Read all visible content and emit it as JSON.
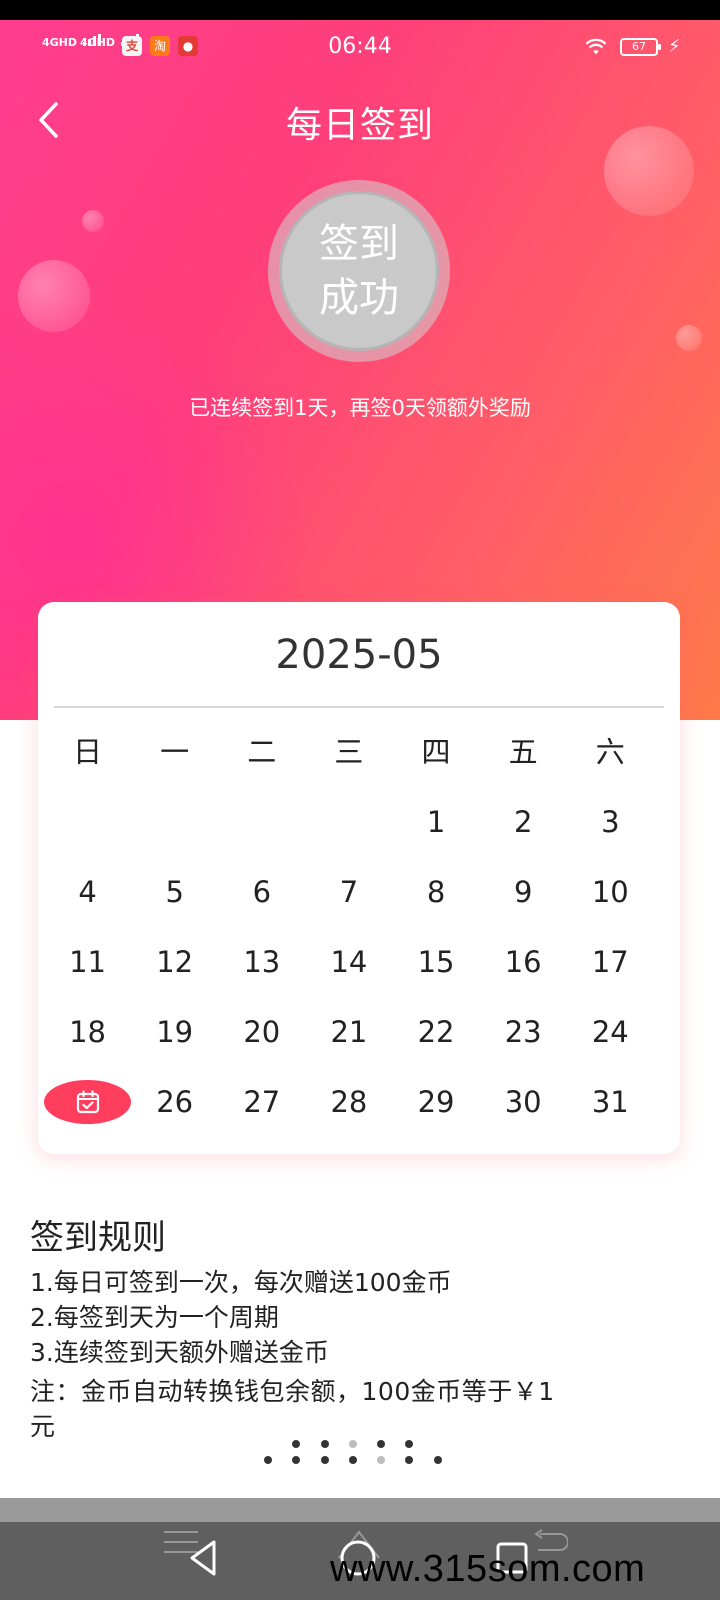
{
  "status_bar": {
    "time": "06:44",
    "signal_1": "4GHD",
    "signal_2": "4GHD",
    "battery": "67",
    "notification_icons": [
      "alipay-icon",
      "taobao-icon",
      "app-red-icon"
    ]
  },
  "header": {
    "title": "每日签到"
  },
  "signin": {
    "line1": "签到",
    "line2": "成功",
    "streak_text": "已连续签到1天，再签0天领额外奖励"
  },
  "calendar": {
    "month": "2025-05",
    "weekdays": [
      "日",
      "一",
      "二",
      "三",
      "四",
      "五",
      "六"
    ],
    "rows": [
      [
        "",
        "",
        "",
        "",
        "1",
        "2",
        "3"
      ],
      [
        "4",
        "5",
        "6",
        "7",
        "8",
        "9",
        "10"
      ],
      [
        "11",
        "12",
        "13",
        "14",
        "15",
        "16",
        "17"
      ],
      [
        "18",
        "19",
        "20",
        "21",
        "22",
        "23",
        "24"
      ],
      [
        "",
        "26",
        "27",
        "28",
        "29",
        "30",
        "31"
      ]
    ],
    "today_icon": "calendar-check-icon"
  },
  "rules": {
    "title": "签到规则",
    "items": [
      "1.每日可签到一次，每次赠送100金币",
      "2.每签到天为一个周期",
      "3.连续签到天额外赠送金币"
    ],
    "note_line1": "注：金币自动转换钱包余额，100金币等于￥1",
    "note_line2": "元"
  },
  "watermark": "www.315som.com",
  "colors": {
    "hero_start": "#ff3d8f",
    "hero_end": "#ff7a4a",
    "today_badge": "#ff3e5e"
  }
}
